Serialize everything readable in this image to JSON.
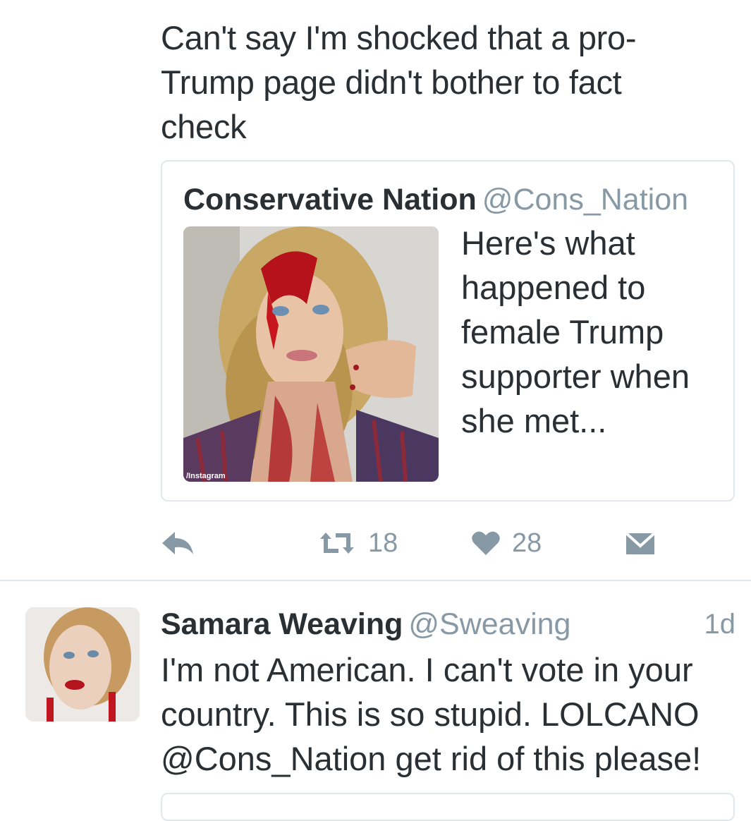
{
  "tweet": {
    "text": "Can't say I'm shocked that a pro-Trump page didn't bother to fact check"
  },
  "quoted": {
    "name": "Conservative Nation",
    "handle": "@Cons_Nation",
    "text": "Here's what happened to female Trump supporter when she met...",
    "media_caption": "/Instagram"
  },
  "actions": {
    "reply_icon": "reply-icon",
    "retweet_icon": "retweet-icon",
    "retweet_count": "18",
    "like_icon": "heart-icon",
    "like_count": "28",
    "dm_icon": "envelope-icon"
  },
  "reply": {
    "name": "Samara Weaving",
    "handle": "@Sweaving",
    "time": "1d",
    "text": "I'm not American. I can't vote in your country. This is so stupid. LOLCANO @Cons_Nation get rid of this please!"
  },
  "colors": {
    "text": "#292f33",
    "muted": "#8899a6",
    "border": "#e1e8ed"
  }
}
